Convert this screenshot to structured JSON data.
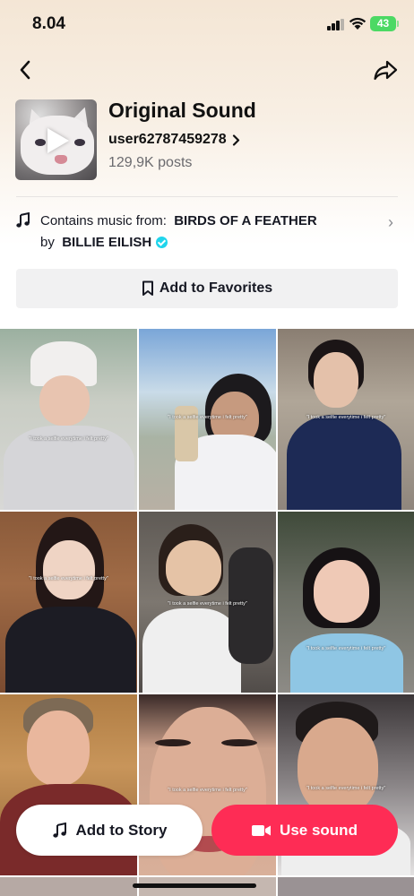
{
  "status_bar": {
    "time": "8.04",
    "battery": "43"
  },
  "nav": {
    "back_icon": "back-chevron-icon",
    "share_icon": "share-arrow-icon"
  },
  "sound": {
    "title": "Original Sound",
    "user": "user62787459278",
    "posts": "129,9K posts"
  },
  "music": {
    "prefix": "Contains music from:",
    "song": "BIRDS OF A FEATHER",
    "by": "by",
    "artist": "BILLIE EILISH"
  },
  "favorites_label": "Add to Favorites",
  "videos": [
    {
      "caption": "\"I took a selfie everytime i felt pretty\""
    },
    {
      "caption": "\"I took a selfie everytime i felt pretty\""
    },
    {
      "caption": "\"I took a selfie everytime i felt pretty\""
    },
    {
      "caption": "\"I took a selfie everytime i felt pretty\""
    },
    {
      "caption": "\"I took a selfie everytime i felt pretty\""
    },
    {
      "caption": "\"I took a selfie everytime i felt pretty\""
    },
    {
      "caption": ""
    },
    {
      "caption": "\"I took a selfie everytime i felt pretty\""
    },
    {
      "caption": "\"I took a selfie everytime i felt pretty\""
    }
  ],
  "actions": {
    "story_label": "Add to Story",
    "use_label": "Use sound"
  },
  "colors": {
    "accent": "#fe2c55",
    "verified": "#20d5ec",
    "battery": "#4cd964"
  }
}
